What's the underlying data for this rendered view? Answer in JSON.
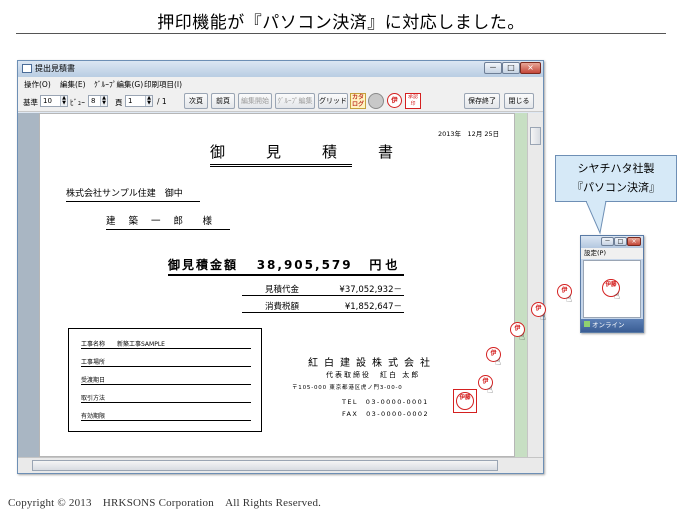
{
  "slide": {
    "title": "押印機能が『パソコン決済』に対応しました。",
    "copyright": "Copyright © 2013　HRKSONS Corporation　All Rights Reserved."
  },
  "window": {
    "title": "提出見積書",
    "min": "－",
    "max": "□",
    "close": "×"
  },
  "menu": [
    "操作(O)",
    "編集(E)",
    "ｸﾞﾙｰﾌﾟ編集(G)",
    "印刷項目(I)"
  ],
  "toolbar": {
    "base_label": "基準",
    "base_value": "10",
    "view_label": "ﾋﾞｭｰ",
    "view_value": "8",
    "page_label": "頁",
    "page_value": "1",
    "page_total": "/ 1",
    "next_btn": "次頁",
    "prev_btn": "前頁",
    "edit_start_btn": "編集開始",
    "group_edit_btn": "ｸﾞﾙｰﾌﾟ編集",
    "grid_btn": "グリッド",
    "catalog_icon": "カタログ",
    "seal_icon": "伊",
    "stamp_icon": "承認印",
    "save_exit_btn": "保存終了",
    "close_btn": "閉じる"
  },
  "document": {
    "date": "2013年　12月 25日",
    "heading": "御　見　積　書",
    "client": "株式会社サンプル住建　御中",
    "person": "建 築 一 郎　様",
    "total_label": "御見積金額",
    "total_value": "38,905,579",
    "total_suffix": "円也",
    "estimate_label": "見積代金",
    "estimate_value": "¥37,052,932－",
    "tax_label": "消費税額",
    "tax_value": "¥1,852,647－",
    "info_rows": [
      {
        "label": "工事名称",
        "value": "新築工事SAMPLE"
      },
      {
        "label": "工事場所",
        "value": ""
      },
      {
        "label": "受渡期日",
        "value": ""
      },
      {
        "label": "取引方法",
        "value": ""
      },
      {
        "label": "有効期限",
        "value": ""
      }
    ],
    "company_name": "紅白建設株式会社",
    "company_rep": "代表取締役　紅白 太郎",
    "company_address": "〒105-000 東京都港区虎ノ門3-00-0",
    "tel": "TEL　03-0000-0001",
    "fax": "FAX　03-0000-0002",
    "seal_text": "伊藤"
  },
  "callout": {
    "line1": "シヤチハタ社製",
    "line2": "『パソコン決済』"
  },
  "widget": {
    "menu": "設定(P)",
    "seal_text": "伊藤",
    "status": "オンライン",
    "close": "×",
    "min": "－",
    "max": "□"
  },
  "colors": {
    "seal_red": "#d42020",
    "callout_fill": "#d6e9f7",
    "doc_green_margin": "#c7dfc3"
  }
}
